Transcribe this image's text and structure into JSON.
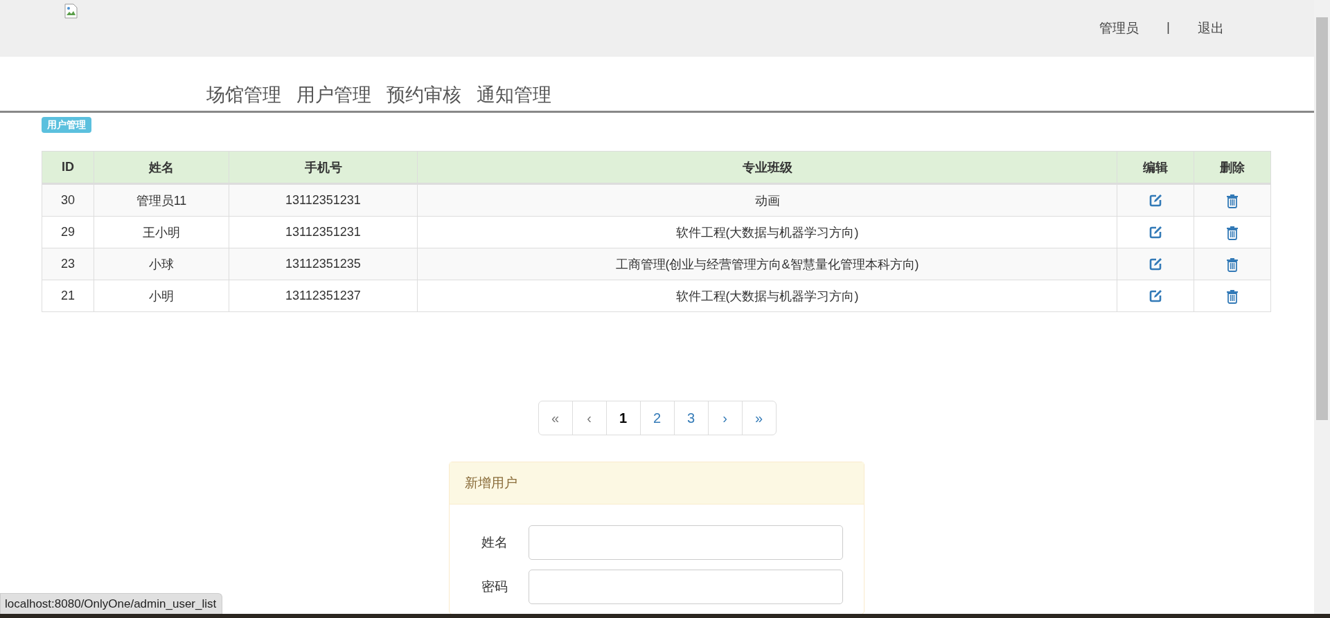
{
  "header": {
    "user": "管理员",
    "separator": "|",
    "logout": "退出"
  },
  "nav": [
    {
      "label": "场馆管理"
    },
    {
      "label": "用户管理"
    },
    {
      "label": "预约审核"
    },
    {
      "label": "通知管理"
    }
  ],
  "badge": "用户管理",
  "table": {
    "columns": [
      "ID",
      "姓名",
      "手机号",
      "专业班级",
      "编辑",
      "删除"
    ],
    "rows": [
      {
        "id": "30",
        "name": "管理员11",
        "phone": "13112351231",
        "major": "动画"
      },
      {
        "id": "29",
        "name": "王小明",
        "phone": "13112351231",
        "major": "软件工程(大数据与机器学习方向)"
      },
      {
        "id": "23",
        "name": "小球",
        "phone": "13112351235",
        "major": "工商管理(创业与经营管理方向&智慧量化管理本科方向)"
      },
      {
        "id": "21",
        "name": "小明",
        "phone": "13112351237",
        "major": "软件工程(大数据与机器学习方向)"
      }
    ]
  },
  "pagination": [
    {
      "label": "«",
      "selected": false,
      "disabled": true
    },
    {
      "label": "‹",
      "selected": false,
      "disabled": true
    },
    {
      "label": "1",
      "selected": true,
      "disabled": false
    },
    {
      "label": "2",
      "selected": false,
      "disabled": false
    },
    {
      "label": "3",
      "selected": false,
      "disabled": false
    },
    {
      "label": "›",
      "selected": false,
      "disabled": false
    },
    {
      "label": "»",
      "selected": false,
      "disabled": false
    }
  ],
  "panel": {
    "title": "新增用户",
    "fields": [
      {
        "label": "姓名"
      },
      {
        "label": "密码"
      }
    ]
  },
  "status_url": "localhost:8080/OnlyOne/admin_user_list"
}
